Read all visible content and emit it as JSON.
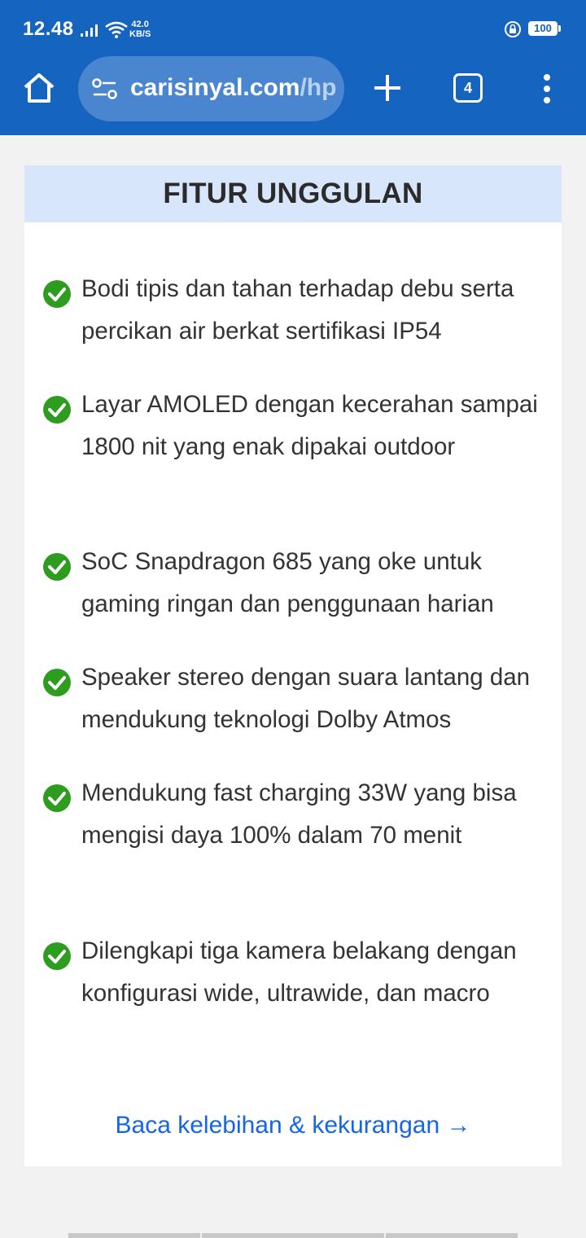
{
  "status_bar": {
    "time": "12.48",
    "net_speed_value": "42.0",
    "net_speed_unit": "KB/S",
    "battery": "100"
  },
  "browser": {
    "url_main": "carisinyal.com",
    "url_rest": "/hp",
    "tab_count": "4"
  },
  "section": {
    "title": "FITUR UNGGULAN",
    "features": [
      "Bodi tipis dan tahan terhadap debu serta percikan air berkat sertifikasi IP54",
      "Layar AMOLED dengan kecerahan sampai 1800 nit yang enak dipakai outdoor",
      "SoC Snapdragon 685 yang oke untuk gaming ringan dan penggunaan harian",
      "Speaker stereo dengan suara lantang dan mendukung teknologi Dolby Atmos",
      "Mendukung fast charging 33W yang bisa mengisi daya 100% dalam 70 menit",
      "Dilengkapi tiga kamera belakang dengan konfigurasi wide, ultrawide, dan macro"
    ],
    "read_more": "Baca kelebihan & kekurangan →"
  },
  "icons": {
    "home": "home-icon",
    "site_settings": "tune-icon",
    "new_tab": "plus-icon",
    "menu": "more-vert-icon",
    "feature_bullet": "check-circle-icon"
  },
  "colors": {
    "toolbar": "#1565c0",
    "header_bg": "#d8e6fb",
    "check": "#2e9d1f",
    "link": "#1565e8"
  }
}
